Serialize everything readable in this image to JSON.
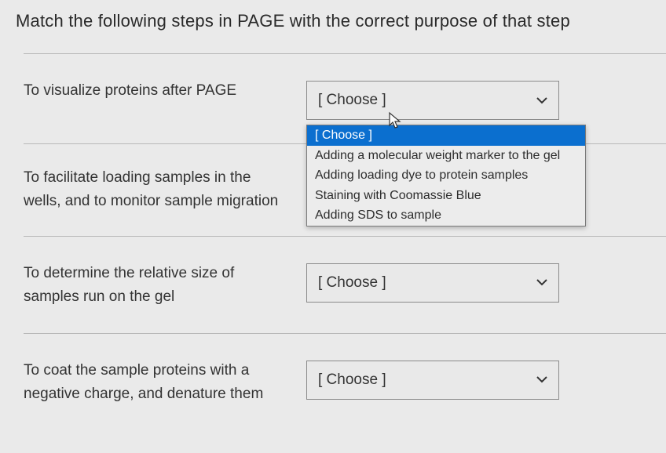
{
  "question": "Match the following steps in PAGE with the correct purpose of that step",
  "placeholder": "[ Choose ]",
  "rows": [
    {
      "prompt": "To visualize proteins after PAGE",
      "open": true
    },
    {
      "prompt": "To facilitate loading samples in the wells, and to monitor sample migration"
    },
    {
      "prompt": "To determine the relative size of samples run on the gel"
    },
    {
      "prompt": "To coat the sample proteins with a negative charge, and denature them"
    }
  ],
  "options": [
    "[ Choose ]",
    "Adding a molecular weight marker to the gel",
    "Adding loading dye to protein samples",
    "Staining with Coomassie Blue",
    "Adding SDS to sample"
  ]
}
